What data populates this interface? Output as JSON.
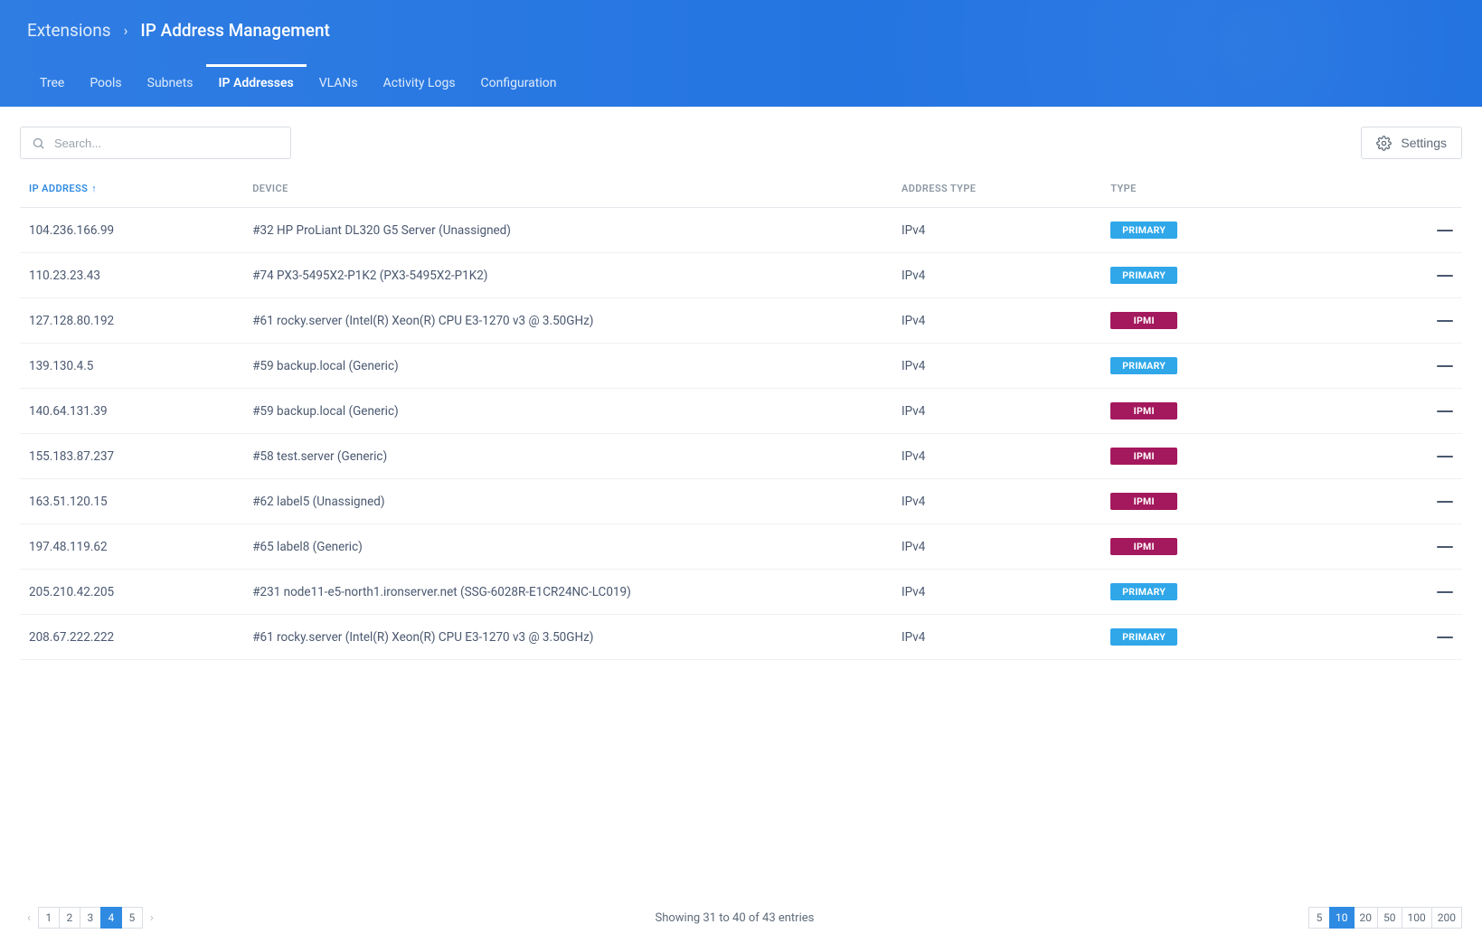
{
  "breadcrumb": {
    "root": "Extensions",
    "current": "IP Address Management"
  },
  "tabs": [
    {
      "label": "Tree",
      "active": false
    },
    {
      "label": "Pools",
      "active": false
    },
    {
      "label": "Subnets",
      "active": false
    },
    {
      "label": "IP Addresses",
      "active": true
    },
    {
      "label": "VLANs",
      "active": false
    },
    {
      "label": "Activity Logs",
      "active": false
    },
    {
      "label": "Configuration",
      "active": false
    }
  ],
  "toolbar": {
    "search_placeholder": "Search...",
    "settings_label": "Settings"
  },
  "table": {
    "columns": {
      "ip": "IP ADDRESS",
      "device": "DEVICE",
      "addr": "ADDRESS TYPE",
      "type": "TYPE"
    },
    "sort": {
      "column": "ip",
      "direction": "asc"
    },
    "rows": [
      {
        "ip": "104.236.166.99",
        "device": "#32 HP ProLiant DL320 G5 Server (Unassigned)",
        "addr_type": "IPv4",
        "type": "PRIMARY"
      },
      {
        "ip": "110.23.23.43",
        "device": "#74 PX3-5495X2-P1K2 (PX3-5495X2-P1K2)",
        "addr_type": "IPv4",
        "type": "PRIMARY"
      },
      {
        "ip": "127.128.80.192",
        "device": "#61 rocky.server (Intel(R) Xeon(R) CPU E3-1270 v3 @ 3.50GHz)",
        "addr_type": "IPv4",
        "type": "IPMI"
      },
      {
        "ip": "139.130.4.5",
        "device": "#59 backup.local (Generic)",
        "addr_type": "IPv4",
        "type": "PRIMARY"
      },
      {
        "ip": "140.64.131.39",
        "device": "#59 backup.local (Generic)",
        "addr_type": "IPv4",
        "type": "IPMI"
      },
      {
        "ip": "155.183.87.237",
        "device": "#58 test.server (Generic)",
        "addr_type": "IPv4",
        "type": "IPMI"
      },
      {
        "ip": "163.51.120.15",
        "device": "#62 label5 (Unassigned)",
        "addr_type": "IPv4",
        "type": "IPMI"
      },
      {
        "ip": "197.48.119.62",
        "device": "#65 label8 (Generic)",
        "addr_type": "IPv4",
        "type": "IPMI"
      },
      {
        "ip": "205.210.42.205",
        "device": "#231 node11-e5-north1.ironserver.net (SSG-6028R-E1CR24NC-LC019)",
        "addr_type": "IPv4",
        "type": "PRIMARY"
      },
      {
        "ip": "208.67.222.222",
        "device": "#61 rocky.server (Intel(R) Xeon(R) CPU E3-1270 v3 @ 3.50GHz)",
        "addr_type": "IPv4",
        "type": "PRIMARY"
      }
    ]
  },
  "footer": {
    "summary": "Showing 31 to 40 of 43 entries",
    "pages": [
      {
        "n": "1"
      },
      {
        "n": "2"
      },
      {
        "n": "3"
      },
      {
        "n": "4",
        "active": true
      },
      {
        "n": "5"
      }
    ],
    "page_sizes": [
      {
        "n": "5"
      },
      {
        "n": "10",
        "active": true
      },
      {
        "n": "20"
      },
      {
        "n": "50"
      },
      {
        "n": "100"
      },
      {
        "n": "200"
      }
    ]
  },
  "badge_colors": {
    "PRIMARY": "primary",
    "IPMI": "ipmi"
  }
}
